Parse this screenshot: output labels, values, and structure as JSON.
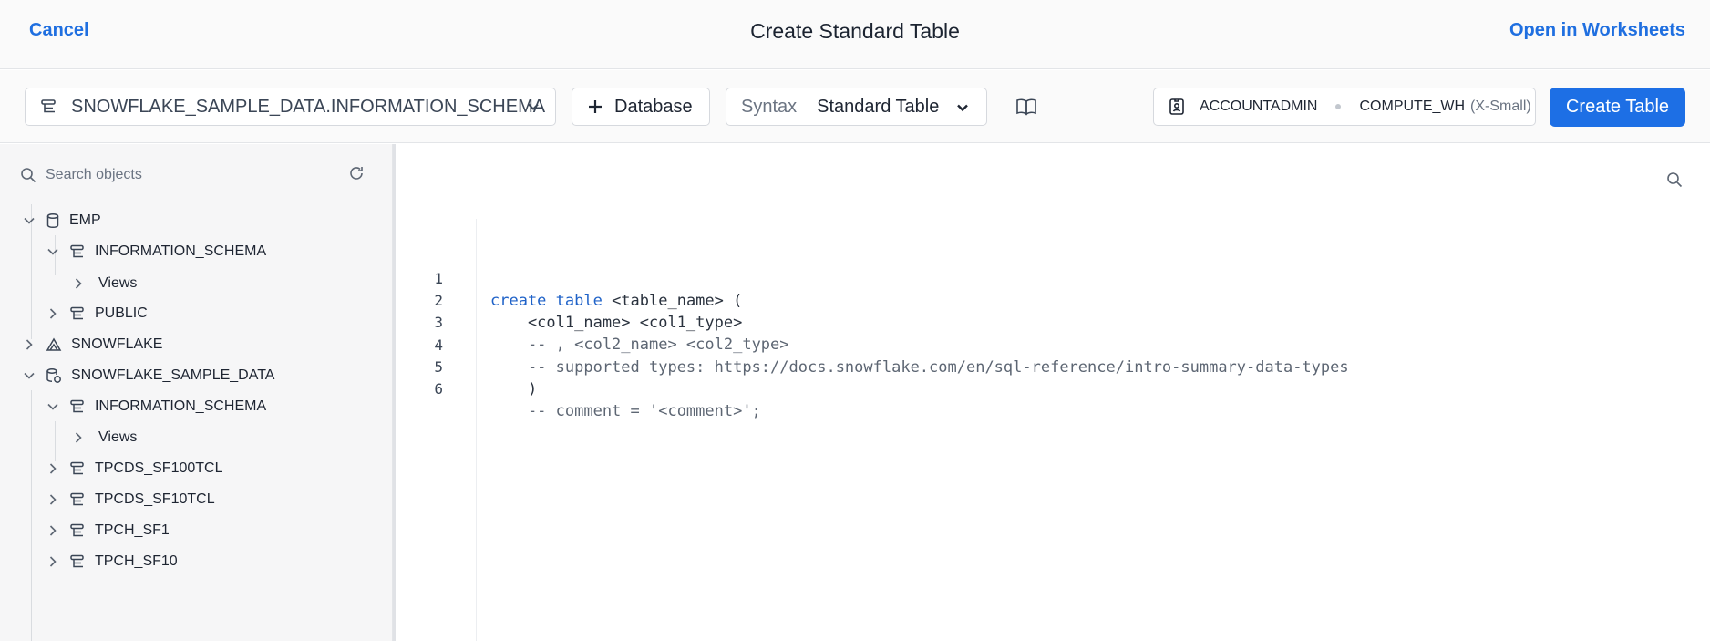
{
  "header": {
    "cancel_label": "Cancel",
    "title": "Create Standard Table",
    "open_worksheets_label": "Open in Worksheets"
  },
  "toolbar": {
    "database_schema": "SNOWFLAKE_SAMPLE_DATA.INFORMATION_SCHEMA",
    "add_database_label": "Database",
    "syntax_label": "Syntax",
    "syntax_value": "Standard Table",
    "role": "ACCOUNTADMIN",
    "warehouse": "COMPUTE_WH",
    "warehouse_size": "(X-Small)",
    "create_label": "Create Table"
  },
  "sidebar": {
    "search_placeholder": "Search objects",
    "tree": [
      {
        "label": "EMP",
        "icon": "database-icon",
        "expanded": true
      },
      {
        "label": "INFORMATION_SCHEMA",
        "icon": "schema-icon",
        "expanded": true
      },
      {
        "label": "Views",
        "icon": "",
        "expanded": false
      },
      {
        "label": "PUBLIC",
        "icon": "schema-icon",
        "expanded": false
      },
      {
        "label": "SNOWFLAKE",
        "icon": "snowflake-share-icon",
        "expanded": false
      },
      {
        "label": "SNOWFLAKE_SAMPLE_DATA",
        "icon": "shared-database-icon",
        "expanded": true
      },
      {
        "label": "INFORMATION_SCHEMA",
        "icon": "schema-icon",
        "expanded": true
      },
      {
        "label": "Views",
        "icon": "",
        "expanded": false
      },
      {
        "label": "TPCDS_SF100TCL",
        "icon": "schema-icon",
        "expanded": false
      },
      {
        "label": "TPCDS_SF10TCL",
        "icon": "schema-icon",
        "expanded": false
      },
      {
        "label": "TPCH_SF1",
        "icon": "schema-icon",
        "expanded": false
      },
      {
        "label": "TPCH_SF10",
        "icon": "schema-icon",
        "expanded": false
      }
    ]
  },
  "editor": {
    "lines": [
      {
        "num": "1",
        "kw": "create table",
        "rest": " <table_name> ("
      },
      {
        "num": "2",
        "kw": "",
        "rest": "    <col1_name> <col1_type>"
      },
      {
        "num": "3",
        "kw": "",
        "rest": "    -- , <col2_name> <col2_type>"
      },
      {
        "num": "4",
        "kw": "",
        "rest": "    -- supported types: https://docs.snowflake.com/en/sql-reference/intro-summary-data-types"
      },
      {
        "num": "5",
        "kw": "",
        "rest": "    )"
      },
      {
        "num": "6",
        "kw": "",
        "rest": "    -- comment = '<comment>';"
      }
    ]
  },
  "colors": {
    "accent": "#1d6fe5",
    "keyword": "#1f62c8"
  }
}
